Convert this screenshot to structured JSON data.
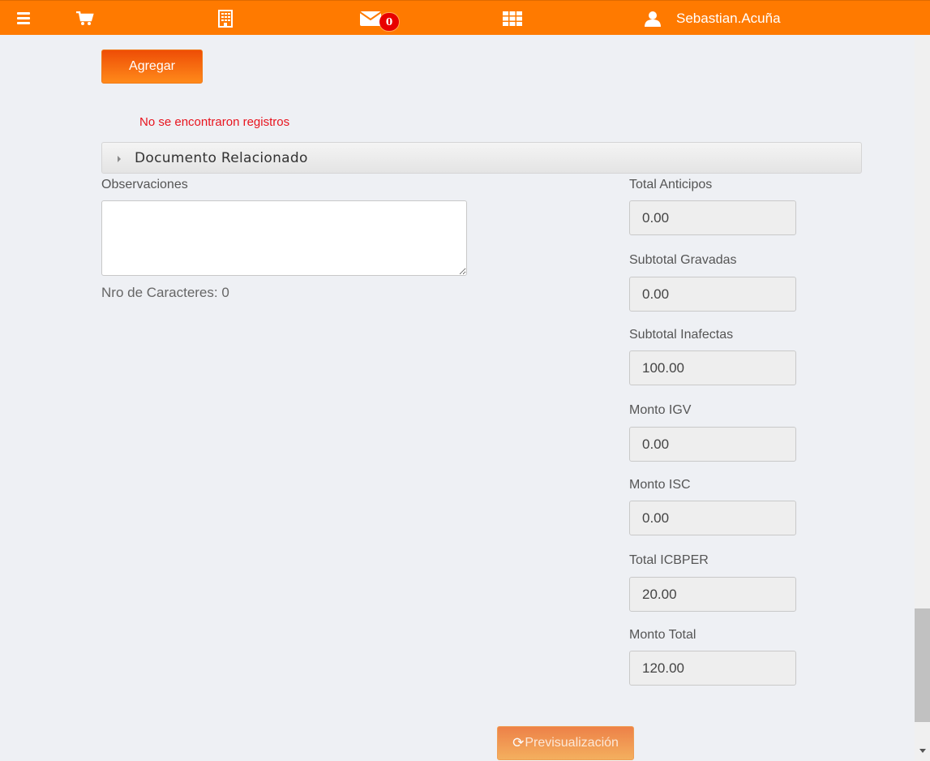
{
  "topbar": {
    "username": "Sebastian.Acuña",
    "mail_count": "0",
    "icons": [
      "menu-icon",
      "cart-icon",
      "building-icon",
      "mail-icon",
      "grid-icon",
      "user-icon"
    ],
    "color": "#ff7a00"
  },
  "actions": {
    "add_label": "Agregar",
    "preview_label": "Previsualización"
  },
  "messages": {
    "no_records": "No se encontraron registros"
  },
  "accordion": {
    "title": "Documento Relacionado"
  },
  "observations": {
    "label": "Observaciones",
    "value": "",
    "char_count": "Nro de Caracteres: 0"
  },
  "totals": {
    "anticipos": {
      "label": "Total Anticipos",
      "value": "0.00"
    },
    "gravadas": {
      "label": "Subtotal Gravadas",
      "value": "0.00"
    },
    "inafectas": {
      "label": "Subtotal Inafectas",
      "value": "100.00"
    },
    "igv": {
      "label": "Monto IGV",
      "value": "0.00"
    },
    "isc": {
      "label": "Monto ISC",
      "value": "0.00"
    },
    "icbper": {
      "label": "Total ICBPER",
      "value": "20.00"
    },
    "total": {
      "label": "Monto Total",
      "value": "120.00"
    }
  }
}
